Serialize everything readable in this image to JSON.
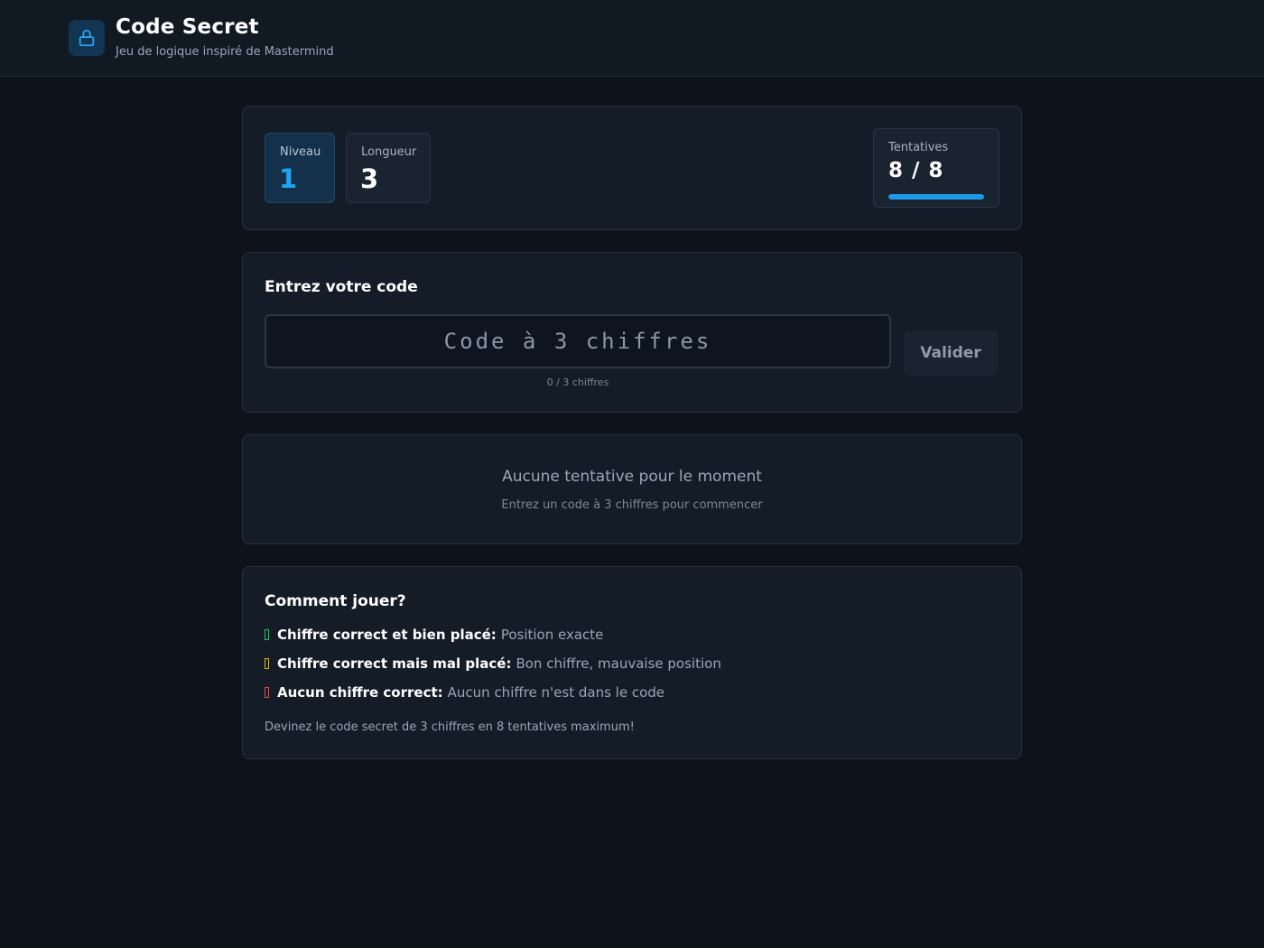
{
  "header": {
    "title": "Code Secret",
    "subtitle": "Jeu de logique inspiré de Mastermind",
    "icon": "lock-icon"
  },
  "stats": {
    "level_label": "Niveau",
    "level_value": "1",
    "length_label": "Longueur",
    "length_value": "3",
    "attempts_label": "Tentatives",
    "attempts_value": "8 / 8",
    "attempts_fraction": 1.0
  },
  "input": {
    "title": "Entrez votre code",
    "placeholder": "Code à 3 chiffres",
    "value": "",
    "validate_label": "Valider",
    "counter": "0 / 3 chiffres"
  },
  "history": {
    "empty_title": "Aucune tentative pour le moment",
    "empty_subtitle": "Entrez un code à 3 chiffres pour commencer"
  },
  "help": {
    "title": "Comment jouer?",
    "rules": [
      {
        "bold": "Chiffre correct et bien placé:",
        "text": "Position exacte",
        "color": "#22c55e"
      },
      {
        "bold": "Chiffre correct mais mal placé:",
        "text": "Bon chiffre, mauvaise position",
        "color": "#eab308"
      },
      {
        "bold": "Aucun chiffre correct:",
        "text": "Aucun chiffre n'est dans le code",
        "color": "#ef4444"
      }
    ],
    "footer": "Devinez le code secret de 3 chiffres en 8 tentatives maximum!"
  },
  "colors": {
    "accent": "#1e9be8",
    "background": "#0d121b",
    "card": "#141c28"
  }
}
